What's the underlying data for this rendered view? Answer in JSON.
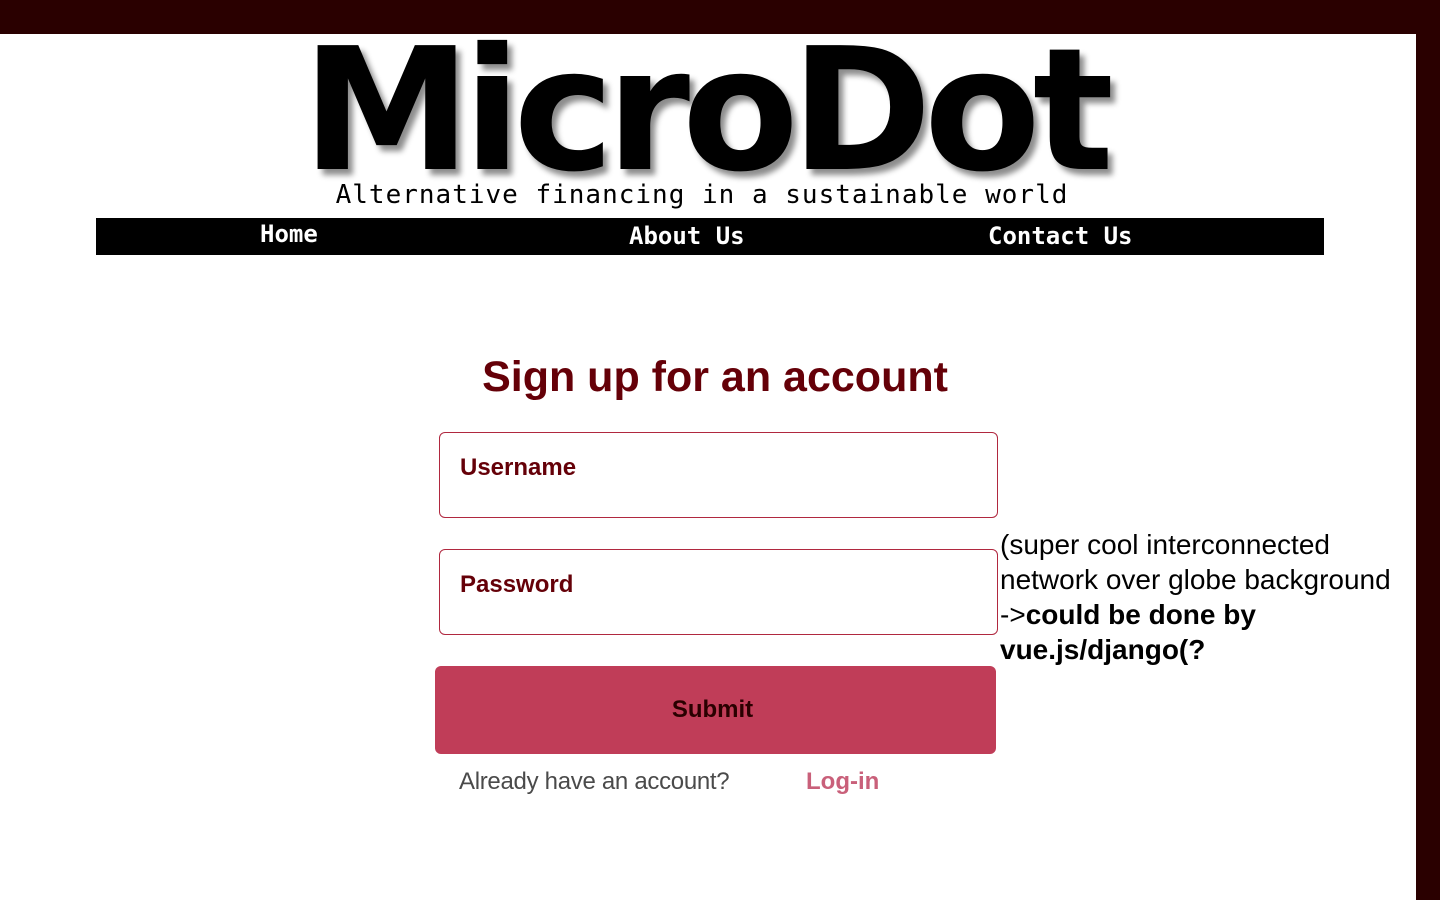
{
  "logo": {
    "text": "MicroDot",
    "tagline": "Alternative financing in a sustainable world"
  },
  "nav": {
    "items": [
      "Home",
      "About Us",
      "Contact Us"
    ]
  },
  "signup": {
    "title": "Sign up for an account",
    "username_label": "Username",
    "password_label": "Password",
    "submit_label": "Submit",
    "already_text": "Already have an account?",
    "login_label": "Log-in"
  },
  "note": {
    "line1": "(super cool interconnected",
    "line2": "network over globe background",
    "line3_prefix": "->",
    "line3_bold": "could be done by",
    "line4_bold": "vue.js/django(?"
  },
  "colors": {
    "frame": "#2a0000",
    "accent": "#650008",
    "button": "#c03d58",
    "link": "#c9607a"
  }
}
